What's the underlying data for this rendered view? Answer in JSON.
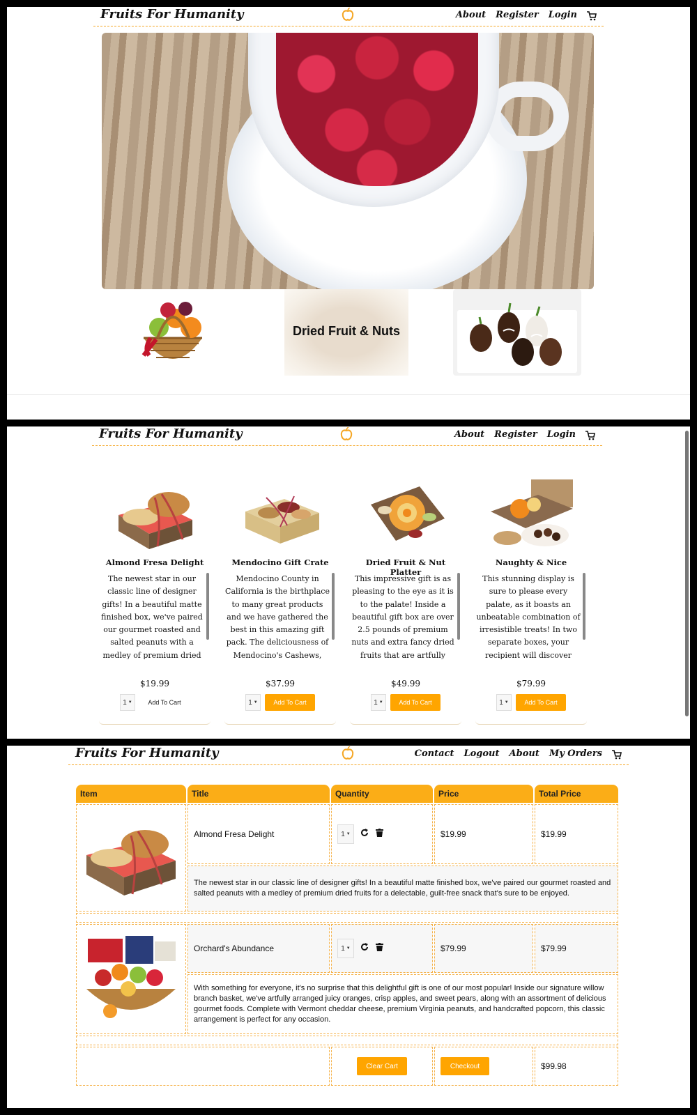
{
  "brand": "Fruits For Humanity",
  "nav_guest": {
    "about": "About",
    "register": "Register",
    "login": "Login"
  },
  "nav_user": {
    "contact": "Contact",
    "logout": "Logout",
    "about": "About",
    "orders": "My Orders"
  },
  "categories": {
    "dried": "Dried Fruit & Nuts"
  },
  "products": [
    {
      "title": "Almond Fresa Delight",
      "desc": "The newest star in our classic line of designer gifts! In a beautiful matte finished box, we've paired our gourmet roasted and salted peanuts with a medley of premium dried fruits for a delectable,",
      "price": "$19.99",
      "qty": "1",
      "add": "Add To Cart"
    },
    {
      "title": "Mendocino Gift Crate",
      "desc": "Mendocino County in California is the birthplace to many great products and we have gathered the best in this amazing gift pack. The deliciousness of Mendocino's Cashews, Almonds, Cherry",
      "price": "$37.99",
      "qty": "1",
      "add": "Add To Cart"
    },
    {
      "title": "Dried Fruit & Nut Platter",
      "desc": "This impressive gift is as pleasing to the eye as it is to the palate! Inside a beautiful gift box are over 2.5 pounds of premium nuts and extra fancy dried fruits that are artfully arranged in an elegant rose",
      "price": "$49.99",
      "qty": "1",
      "add": "Add To Cart"
    },
    {
      "title": "Naughty & Nice",
      "desc": "This stunning display is sure to please every palate, as it boasts an unbeatable combination of irresistible treats! In two separate boxes, your recipient will discover beautiful arrangements of",
      "price": "$79.99",
      "qty": "1",
      "add": "Add To Cart"
    }
  ],
  "cart": {
    "headers": {
      "item": "Item",
      "title": "Title",
      "quantity": "Quantity",
      "price": "Price",
      "total": "Total Price"
    },
    "rows": [
      {
        "title": "Almond Fresa Delight",
        "qty": "1",
        "price": "$19.99",
        "total": "$19.99",
        "desc": "The newest star in our classic line of designer gifts! In a beautiful matte finished box, we've paired our gourmet roasted and salted peanuts with a medley of premium dried fruits for a delectable, guilt-free snack that's sure to be enjoyed."
      },
      {
        "title": "Orchard's Abundance",
        "qty": "1",
        "price": "$79.99",
        "total": "$79.99",
        "desc": "With something for everyone, it's no surprise that this delightful gift is one of our most popular! Inside our signature willow branch basket, we've artfully arranged juicy oranges, crisp apples, and sweet pears, along with an assortment of delicious gourmet foods. Complete with Vermont cheddar cheese, premium Virginia peanuts, and handcrafted popcorn, this classic arrangement is perfect for any occasion."
      }
    ],
    "clear": "Clear Cart",
    "checkout": "Checkout",
    "grand_total": "$99.98"
  },
  "colors": {
    "accent": "#ffa500",
    "header": "#fbad17",
    "dashed": "#f5b24a"
  },
  "icons": {
    "apple": "apple-logo-icon",
    "cart": "shopping-cart-icon",
    "refresh": "refresh-icon",
    "trash": "trash-icon",
    "caret": "caret-down-icon"
  }
}
